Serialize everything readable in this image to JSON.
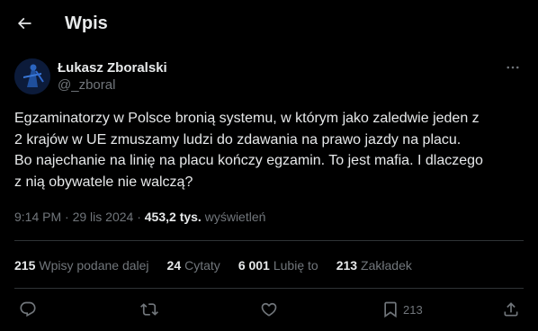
{
  "header": {
    "title": "Wpis",
    "back_icon": "arrow-left-icon"
  },
  "author": {
    "display_name": "Łukasz Zboralski",
    "handle": "@_zboral",
    "more_icon": "more-horizontal-icon"
  },
  "tweet": {
    "lines": [
      "Egzaminatorzy w Polsce bronią systemu, w którym jako zaledwie jeden z",
      "2 krajów w UE zmuszamy ludzi do zdawania na prawo jazdy na placu.",
      "Bo najechanie na linię na placu kończy egzamin. To jest mafia. I dlaczego",
      "z nią obywatele nie walczą?"
    ]
  },
  "meta": {
    "time": "9:14 PM",
    "separator": " · ",
    "date": "29 lis 2024",
    "views_count": "453,2 tys.",
    "views_label": "wyświetleń"
  },
  "stats": [
    {
      "value": "215",
      "label": "Wpisy podane dalej"
    },
    {
      "value": "24",
      "label": "Cytaty"
    },
    {
      "value": "6 001",
      "label": "Lubię to"
    },
    {
      "value": "213",
      "label": "Zakładek"
    }
  ],
  "actions": {
    "reply_icon": "reply-icon",
    "retweet_icon": "retweet-icon",
    "like_icon": "heart-icon",
    "bookmark_icon": "bookmark-icon",
    "bookmark_count": "213",
    "share_icon": "share-icon"
  },
  "colors": {
    "background": "#000000",
    "text_primary": "#e7e9ea",
    "text_secondary": "#71767b",
    "divider": "#2f3336"
  }
}
